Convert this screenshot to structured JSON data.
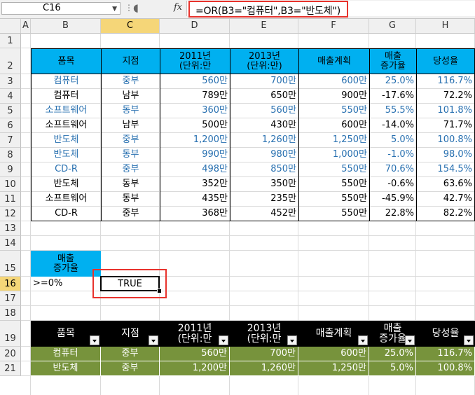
{
  "formula_bar": {
    "name_box": "C16",
    "fx_label": "fx",
    "formula": "=OR(B3=\"컴퓨터\",B3=\"반도체\")"
  },
  "columns": [
    "A",
    "B",
    "C",
    "D",
    "E",
    "F",
    "G",
    "H"
  ],
  "rows": [
    "1",
    "2",
    "3",
    "4",
    "5",
    "6",
    "7",
    "8",
    "9",
    "10",
    "11",
    "12",
    "13",
    "14",
    "15",
    "16",
    "17",
    "18",
    "19",
    "20",
    "21"
  ],
  "table1": {
    "headers": [
      "품목",
      "지점",
      "2011년\n(단위:만",
      "2013년\n(단위:만)",
      "매출계획",
      "매출\n증가율",
      "당성율"
    ],
    "rows": [
      {
        "hl": true,
        "cells": [
          "컴퓨터",
          "중부",
          "560만",
          "700만",
          "600만",
          "25.0%",
          "116.7%"
        ]
      },
      {
        "hl": false,
        "cells": [
          "컴퓨터",
          "남부",
          "789만",
          "650만",
          "900만",
          "-17.6%",
          "72.2%"
        ]
      },
      {
        "hl": true,
        "cells": [
          "소프트웨어",
          "동부",
          "360만",
          "560만",
          "550만",
          "55.5%",
          "101.8%"
        ]
      },
      {
        "hl": false,
        "cells": [
          "소프트웨어",
          "남부",
          "500만",
          "430만",
          "600만",
          "-14.0%",
          "71.7%"
        ]
      },
      {
        "hl": true,
        "cells": [
          "반도체",
          "중부",
          "1,200만",
          "1,260만",
          "1,250만",
          "5.0%",
          "100.8%"
        ]
      },
      {
        "hl": true,
        "cells": [
          "반도체",
          "동부",
          "990만",
          "980만",
          "1,000만",
          "-1.0%",
          "98.0%"
        ]
      },
      {
        "hl": true,
        "cells": [
          "CD-R",
          "중부",
          "498만",
          "850만",
          "550만",
          "70.6%",
          "154.5%"
        ]
      },
      {
        "hl": false,
        "cells": [
          "반도체",
          "동부",
          "352만",
          "350만",
          "550만",
          "-0.6%",
          "63.6%"
        ]
      },
      {
        "hl": false,
        "cells": [
          "소프트웨어",
          "동부",
          "435만",
          "235만",
          "550만",
          "-45.9%",
          "42.7%"
        ]
      },
      {
        "hl": false,
        "cells": [
          "CD-R",
          "중부",
          "368만",
          "452만",
          "550만",
          "22.8%",
          "82.2%"
        ]
      }
    ]
  },
  "criteria": {
    "header": "매출\n증가율",
    "b16": ">=0%",
    "c16": "TRUE"
  },
  "table2": {
    "headers": [
      "품목",
      "지점",
      "2011년\n(단위:만",
      "2013년\n(단위:만",
      "매출계획",
      "매출\n증가율",
      "당성율"
    ],
    "rows": [
      [
        "컴퓨터",
        "중부",
        "560만",
        "700만",
        "600만",
        "25.0%",
        "116.7%"
      ],
      [
        "반도체",
        "중부",
        "1,200만",
        "1,260만",
        "1,250만",
        "5.0%",
        "100.8%"
      ]
    ]
  },
  "colors": {
    "header_blue": "#00b0f0",
    "highlight_text": "#2870b0",
    "dark_header": "#000000",
    "green_row": "#77933c",
    "selection_red": "#e8332d"
  }
}
